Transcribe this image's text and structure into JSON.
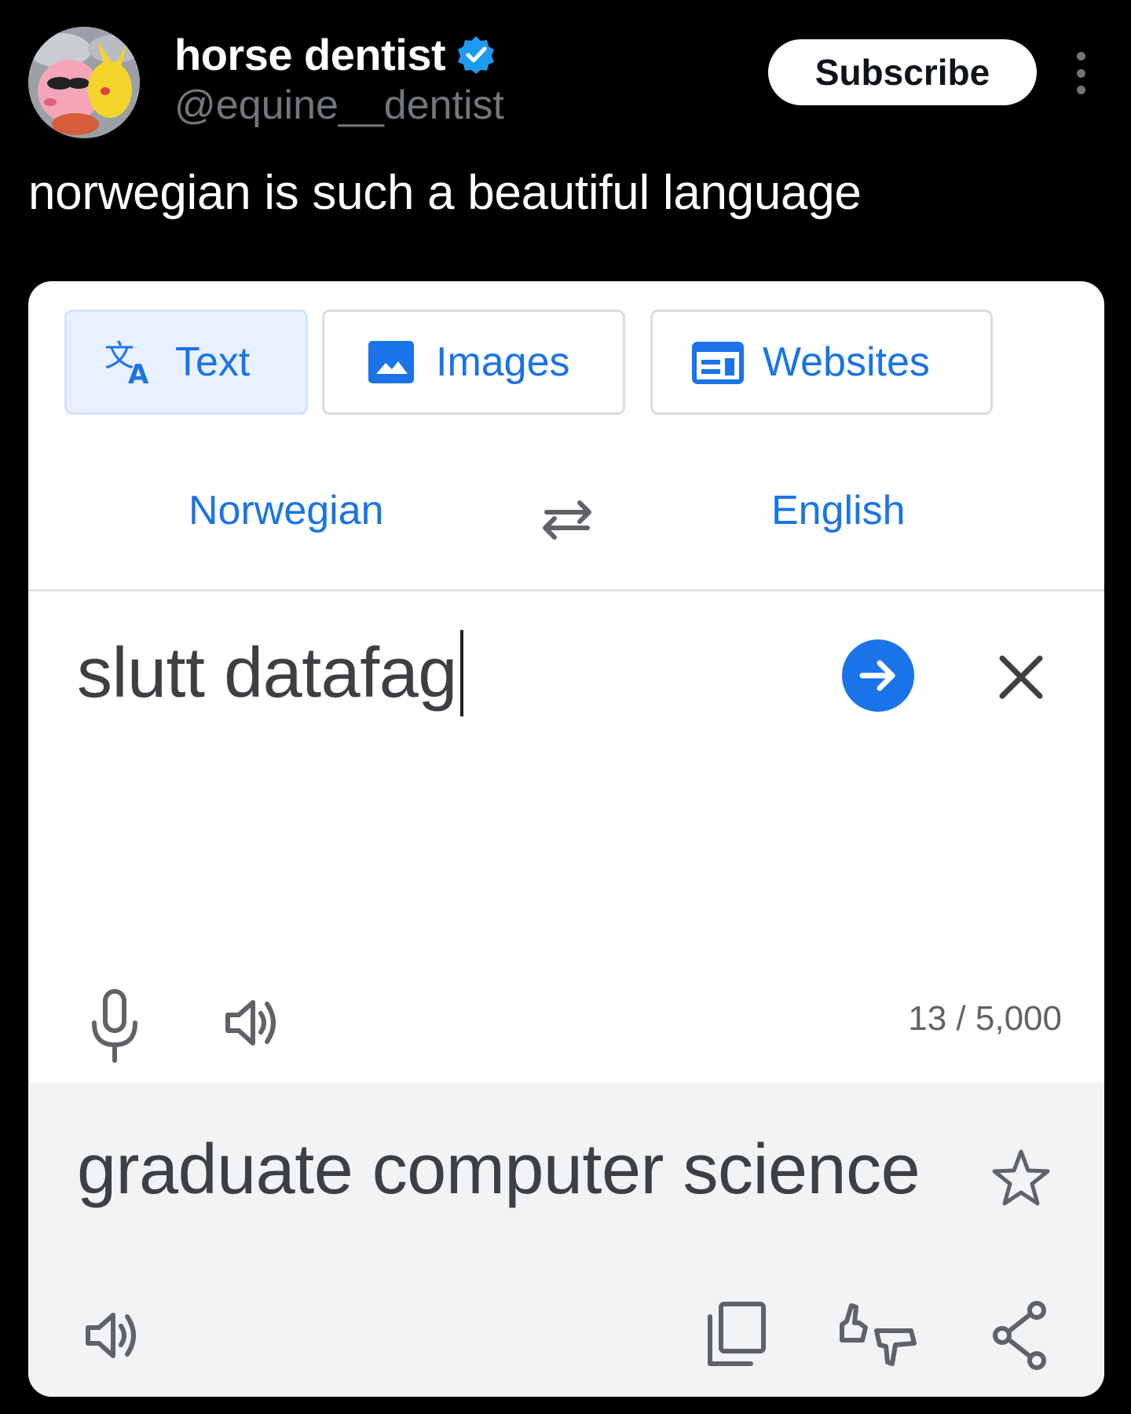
{
  "tweet": {
    "display_name": "horse dentist",
    "handle": "@equine__dentist",
    "subscribe_label": "Subscribe",
    "text": "norwegian is such a beautiful language"
  },
  "translate": {
    "tabs": [
      {
        "label": "Text",
        "icon": "translate-icon",
        "active": true
      },
      {
        "label": "Images",
        "icon": "image-icon",
        "active": false
      },
      {
        "label": "Websites",
        "icon": "website-icon",
        "active": false
      }
    ],
    "source_language": "Norwegian",
    "target_language": "English",
    "source_text": "slutt datafag",
    "char_count": "13 / 5,000",
    "result_text": "graduate computer science"
  },
  "colors": {
    "background": "#000000",
    "accent_blue": "#1a73e8",
    "verified_blue": "#1d9bf0",
    "muted_gray": "#71767b",
    "result_panel": "#f1f3f4"
  }
}
